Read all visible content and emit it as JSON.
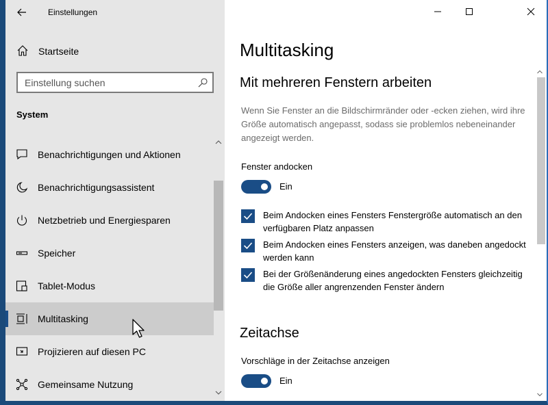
{
  "window": {
    "title": "Einstellungen"
  },
  "sidebar": {
    "home_label": "Startseite",
    "search_placeholder": "Einstellung suchen",
    "section_title": "System",
    "items": [
      {
        "label": "Benachrichtigungen und Aktionen",
        "icon": "notification-icon"
      },
      {
        "label": "Benachrichtigungsassistent",
        "icon": "moon-icon"
      },
      {
        "label": "Netzbetrieb und Energiesparen",
        "icon": "power-icon"
      },
      {
        "label": "Speicher",
        "icon": "storage-icon"
      },
      {
        "label": "Tablet-Modus",
        "icon": "tablet-icon"
      },
      {
        "label": "Multitasking",
        "icon": "multitasking-icon",
        "active": true
      },
      {
        "label": "Projizieren auf diesen PC",
        "icon": "project-icon"
      },
      {
        "label": "Gemeinsame Nutzung",
        "icon": "share-icon"
      }
    ]
  },
  "main": {
    "page_title": "Multitasking",
    "windows_section": {
      "heading": "Mit mehreren Fenstern arbeiten",
      "description": "Wenn Sie Fenster an die Bildschirmränder oder -ecken ziehen, wird ihre Größe automatisch angepasst, sodass sie problemlos nebeneinander angezeigt werden.",
      "snap_label": "Fenster andocken",
      "snap_state": "Ein",
      "checkboxes": [
        {
          "text": "Beim Andocken eines Fensters Fenstergröße automatisch an den verfügbaren Platz anpassen",
          "checked": true
        },
        {
          "text": "Beim Andocken eines Fensters anzeigen, was daneben angedockt werden kann",
          "checked": true
        },
        {
          "text": "Bei der Größenänderung eines angedockten Fensters gleichzeitig die Größe aller angrenzenden Fenster ändern",
          "checked": true
        }
      ]
    },
    "timeline_section": {
      "heading": "Zeitachse",
      "suggestions_label": "Vorschläge in der Zeitachse anzeigen",
      "suggestions_state": "Ein"
    }
  },
  "colors": {
    "accent": "#1a4d86",
    "sidebar_bg": "#e6e6e6",
    "active_item_bg": "#cccccc"
  }
}
